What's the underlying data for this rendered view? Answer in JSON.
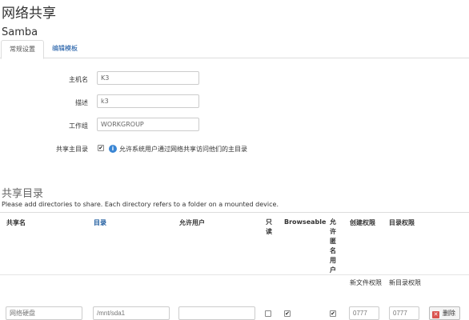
{
  "page_title": "网络共享",
  "section_title": "Samba",
  "tabs": [
    {
      "label": "常规设置",
      "active": true
    },
    {
      "label": "编辑模板",
      "active": false
    }
  ],
  "general": {
    "hostname": {
      "label": "主机名",
      "value": "K3"
    },
    "description": {
      "label": "描述",
      "value": "k3"
    },
    "workgroup": {
      "label": "工作组",
      "value": "WORKGROUP"
    },
    "share_home": {
      "label": "共享主目录",
      "checked": true,
      "hint": "允许系统用户通过网络共享访问他们的主目录"
    }
  },
  "shares": {
    "title": "共享目录",
    "description": "Please add directories to share. Each directory refers to a folder on a mounted device.",
    "columns": {
      "name": "共享名",
      "path": "目录",
      "users": "允许用户",
      "readonly": "只读",
      "browseable": "Browseable",
      "guest": "允许匿名用户",
      "create_mask": "创建权限",
      "dir_mask": "目录权限"
    },
    "subheaders": {
      "create_mask": "新文件权限",
      "dir_mask": "新目录权限"
    },
    "rows": [
      {
        "name_placeholder": "网络硬盘",
        "path_placeholder": "/mnt/sda1",
        "users_value": "",
        "readonly": false,
        "browseable": true,
        "guest": true,
        "create_mask_placeholder": "0777",
        "dir_mask_placeholder": "0777",
        "delete_label": "删除"
      }
    ]
  },
  "colors": {
    "link": "#0a4d9e",
    "info_icon": "#3a86d4",
    "delete_icon": "#d9534f"
  }
}
